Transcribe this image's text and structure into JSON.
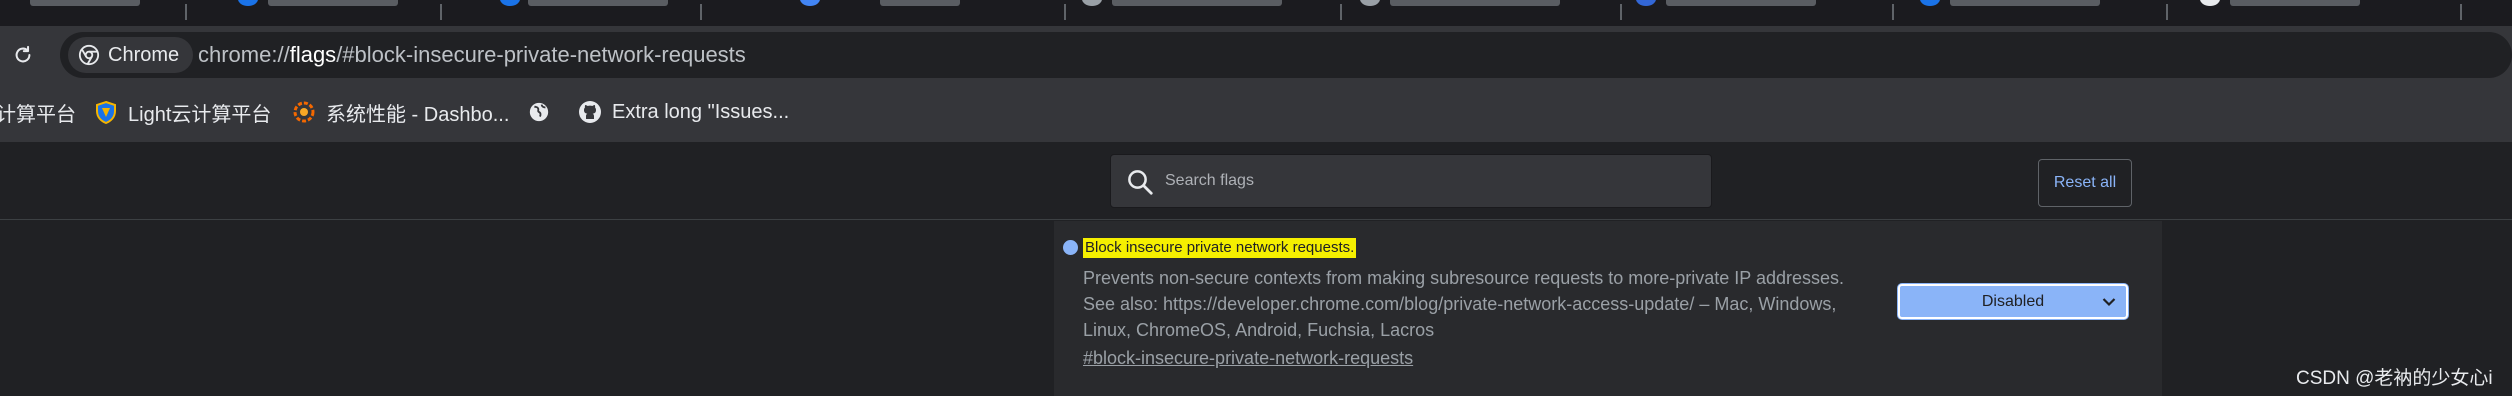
{
  "browser": {
    "chip_label": "Chrome",
    "url_scheme": "chrome://",
    "url_host": "flags",
    "url_path": "/#block-insecure-private-network-requests"
  },
  "bookmarks": [
    {
      "label": "计算平台",
      "icon": "partial-icon"
    },
    {
      "label": "Light云计算平台",
      "icon": "shield-icon"
    },
    {
      "label": "系统性能 - Dashbo...",
      "icon": "grafana-icon"
    },
    {
      "label": "",
      "icon": "globe-icon"
    },
    {
      "label": "Extra long \"Issues...",
      "icon": "github-icon"
    }
  ],
  "flags_header": {
    "search_placeholder": "Search flags",
    "reset_label": "Reset all"
  },
  "flag": {
    "title": "Block insecure private network requests.",
    "description": "Prevents non-secure contexts from making subresource requests to more-private IP addresses. See also: https://developer.chrome.com/blog/private-network-access-update/ – Mac, Windows, Linux, ChromeOS, Android, Fuchsia, Lacros",
    "permalink": "#block-insecure-private-network-requests",
    "selected_option": "Disabled"
  },
  "watermark": "CSDN @老衲的少女心i",
  "colors": {
    "accent": "#8ab4f8",
    "highlight": "#f5ef00",
    "background": "#202124",
    "panel": "#292a2d"
  }
}
